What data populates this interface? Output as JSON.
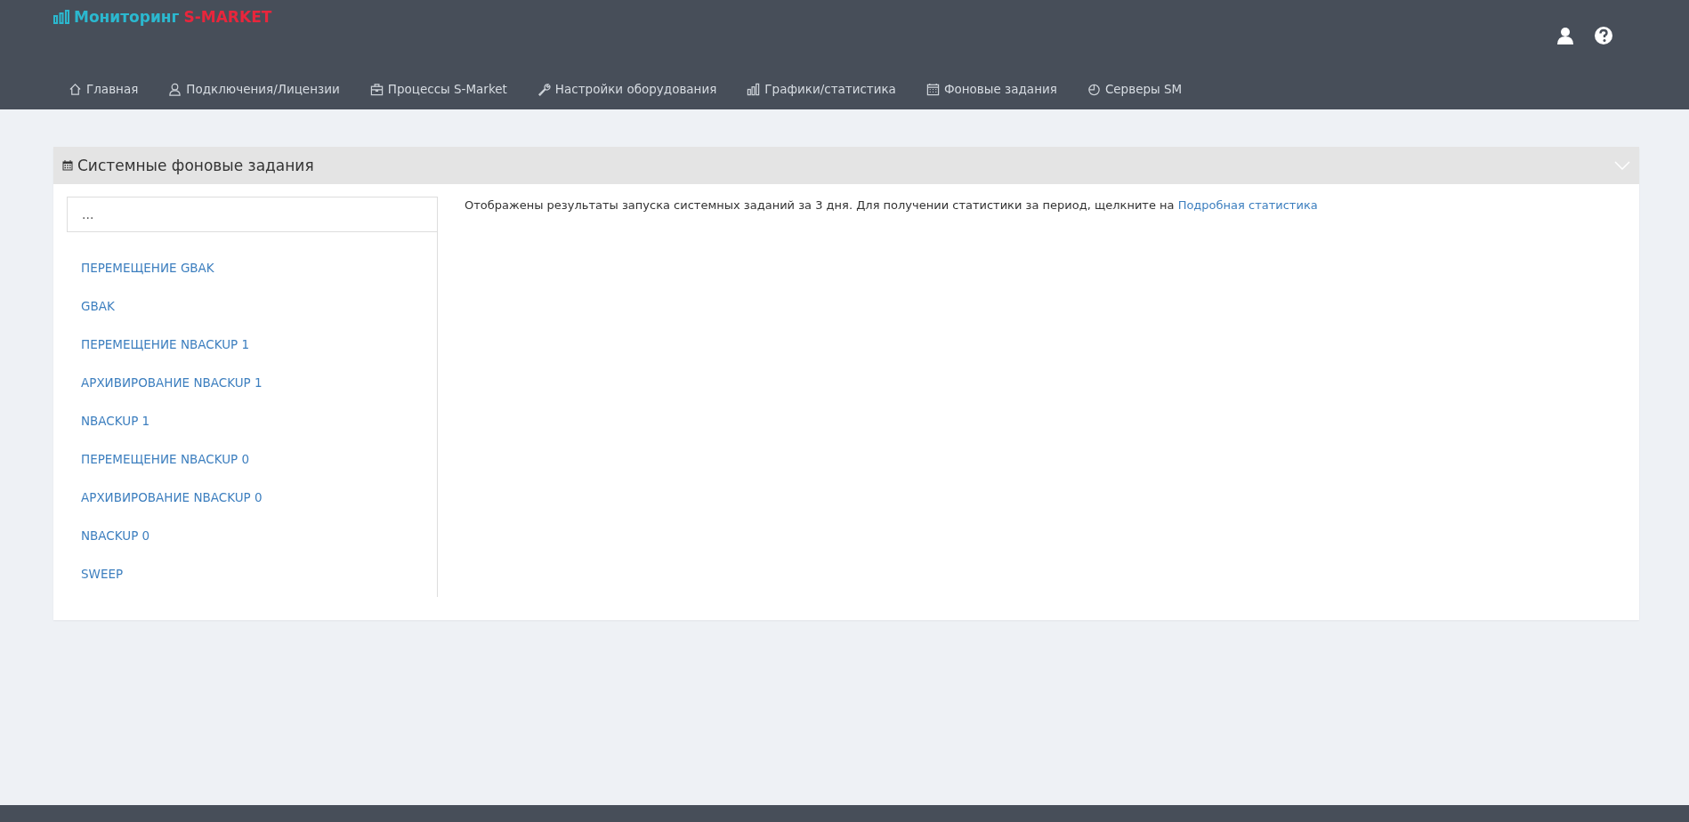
{
  "brand": {
    "title": "Мониторинг",
    "accent": "S-MARKET"
  },
  "nav": [
    {
      "label": "Главная",
      "kind": "home"
    },
    {
      "label": "Подключения/Лицензии",
      "kind": "user"
    },
    {
      "label": "Процессы S-Market",
      "kind": "briefcase"
    },
    {
      "label": "Настройки оборудования",
      "kind": "wrench"
    },
    {
      "label": "Графики/статистика",
      "kind": "chart"
    },
    {
      "label": "Фоновые задания",
      "kind": "calendar"
    },
    {
      "label": "Серверы SM",
      "kind": "clock"
    }
  ],
  "panel": {
    "title": "Системные фоновые задания",
    "search": {
      "value": "..."
    },
    "tasks": [
      "ПЕРЕМЕЩЕНИЕ GBAK",
      "GBAK",
      "ПЕРЕМЕЩЕНИЕ NBACKUP 1",
      "АРХИВИРОВАНИЕ NBACKUP 1",
      "NBACKUP 1",
      "ПЕРЕМЕЩЕНИЕ NBACKUP 0",
      "АРХИВИРОВАНИЕ NBACKUP 0",
      "NBACKUP 0",
      "SWEEP"
    ],
    "info": "Отображены результаты запуска системных заданий за 3 дня. Для получении статистики за период, щелкните на",
    "link": "Подробная статистика"
  }
}
